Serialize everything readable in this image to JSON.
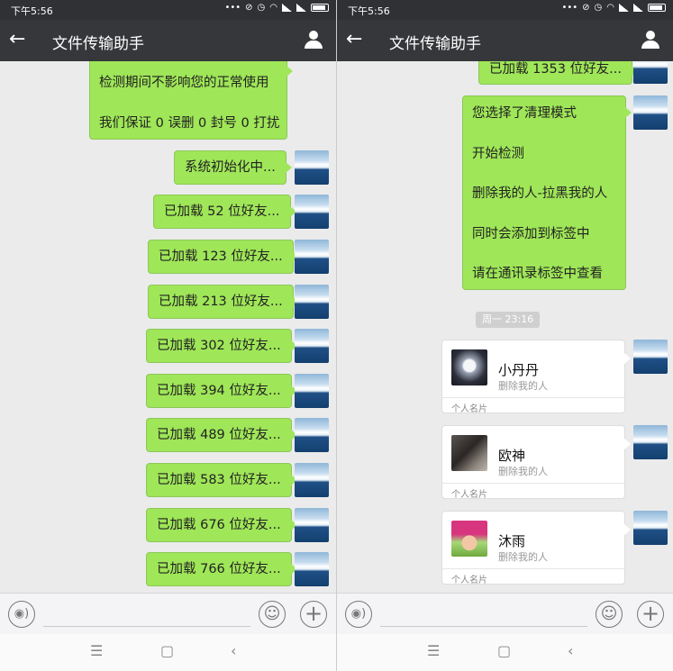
{
  "status_bar": {
    "time": "下午5:56",
    "icons": [
      "dots-icon",
      "mute-icon",
      "alarm-icon",
      "wifi-icon",
      "signal-icon",
      "signal-icon",
      "battery-icon"
    ]
  },
  "title_bar": {
    "back": "←",
    "title": "文件传输助手"
  },
  "left_messages": {
    "intro": [
      "检测期间不影响您的正常使用",
      "我们保证 0 误删 0 封号 0 打扰"
    ],
    "init": "系统初始化中...",
    "loaded": [
      "已加载 52 位好友...",
      "已加载 123 位好友...",
      "已加载 213 位好友...",
      "已加载 302 位好友...",
      "已加载 394 位好友...",
      "已加载 489 位好友...",
      "已加载 583 位好友...",
      "已加载 676 位好友...",
      "已加载 766 位好友..."
    ]
  },
  "right_messages": {
    "loaded": "已加载 1353 位好友...",
    "mode": [
      "您选择了清理模式",
      "开始检测",
      "删除我的人-拉黑我的人",
      "同时会添加到标签中",
      "请在通讯录标签中查看"
    ],
    "timestamp": "周一 23:16",
    "cards": [
      {
        "name": "小丹丹",
        "sub": "删除我的人",
        "footer": "个人名片"
      },
      {
        "name": "欧神",
        "sub": "删除我的人",
        "footer": "个人名片"
      },
      {
        "name": "沐雨",
        "sub": "删除我的人",
        "footer": "个人名片"
      }
    ]
  },
  "input_bar": {
    "voice": "◉)",
    "emoji": "☺",
    "plus": "+"
  },
  "nav_bar": {
    "menu": "☰",
    "home": "▢",
    "back": "‹"
  },
  "colors": {
    "bubble_green": "#9fe658",
    "header": "#35373a",
    "status_bar": "#2f3134",
    "chat_bg": "#ebebeb"
  }
}
